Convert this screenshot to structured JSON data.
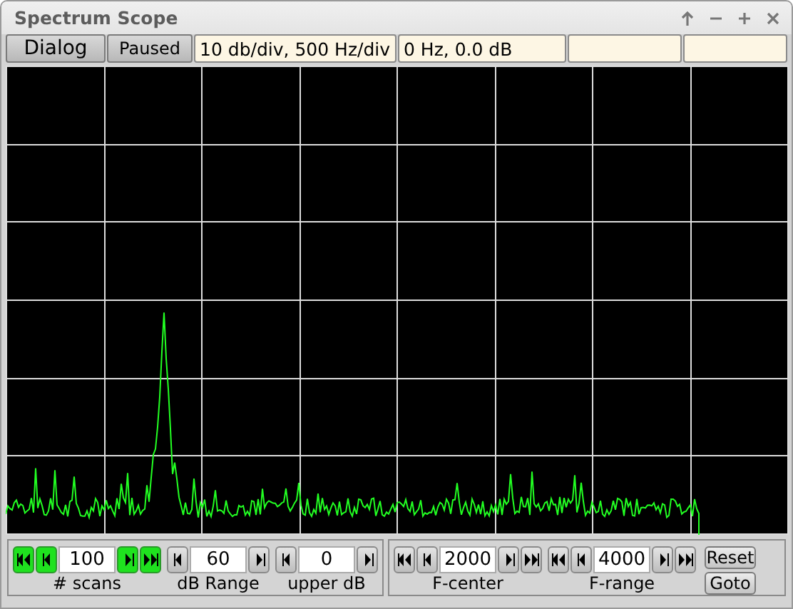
{
  "window": {
    "title": "Spectrum Scope"
  },
  "status_bar": {
    "menu_button": "Dialog",
    "state_button": "Paused",
    "scale": "10 db/div, 500 Hz/div",
    "cursor": "0 Hz, 0.0 dB"
  },
  "left_controls": [
    {
      "kind": "double",
      "label": "# scans",
      "value": "100",
      "highlighted": true
    },
    {
      "kind": "single",
      "label": "dB Range",
      "value": "60",
      "highlighted": false
    },
    {
      "kind": "single",
      "label": "upper dB",
      "value": "0",
      "highlighted": false
    }
  ],
  "right_controls": [
    {
      "kind": "double",
      "label": "F-center",
      "value": "2000",
      "highlighted": false
    },
    {
      "kind": "double",
      "label": "F-range",
      "value": "4000",
      "highlighted": false
    }
  ],
  "buttons": [
    "Reset",
    "Goto"
  ]
}
